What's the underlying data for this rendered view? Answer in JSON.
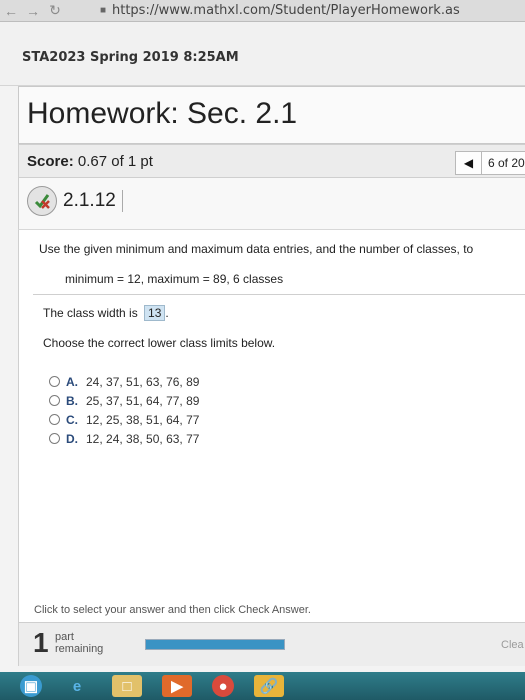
{
  "browser": {
    "url": "https://www.mathxl.com/Student/PlayerHomework.as"
  },
  "course": {
    "title": "STA2023 Spring 2019 8:25AM"
  },
  "homework": {
    "title": "Homework: Sec. 2.1"
  },
  "score": {
    "label": "Score:",
    "value": "0.67 of 1 pt"
  },
  "pager": {
    "prev_icon": "left-triangle",
    "count": "6 of 20"
  },
  "question": {
    "number": "2.1.12",
    "instruction": "Use the given minimum and maximum data entries, and the number of classes, to",
    "given": "minimum = 12,  maximum = 89, 6 classes",
    "class_width_label": "The class width is",
    "class_width_value": "13",
    "class_width_suffix": ".",
    "choose_prompt": "Choose the correct lower class limits below.",
    "options": [
      {
        "letter": "A.",
        "text": "24, 37, 51, 63, 76, 89"
      },
      {
        "letter": "B.",
        "text": "25, 37, 51, 64, 77, 89"
      },
      {
        "letter": "C.",
        "text": "12, 25, 38, 51, 64, 77"
      },
      {
        "letter": "D.",
        "text": "12, 24, 38, 50, 63, 77"
      }
    ]
  },
  "footer": {
    "hint": "Click to select your answer and then click Check Answer.",
    "parts_count": "1",
    "parts_word": "part",
    "remaining_word": "remaining",
    "progress": 1.0,
    "clear_label": "Clea"
  },
  "colors": {
    "progress": "#3a93c4",
    "highlight": "#cfe3f2",
    "taskbar": "#2f7d8a"
  }
}
